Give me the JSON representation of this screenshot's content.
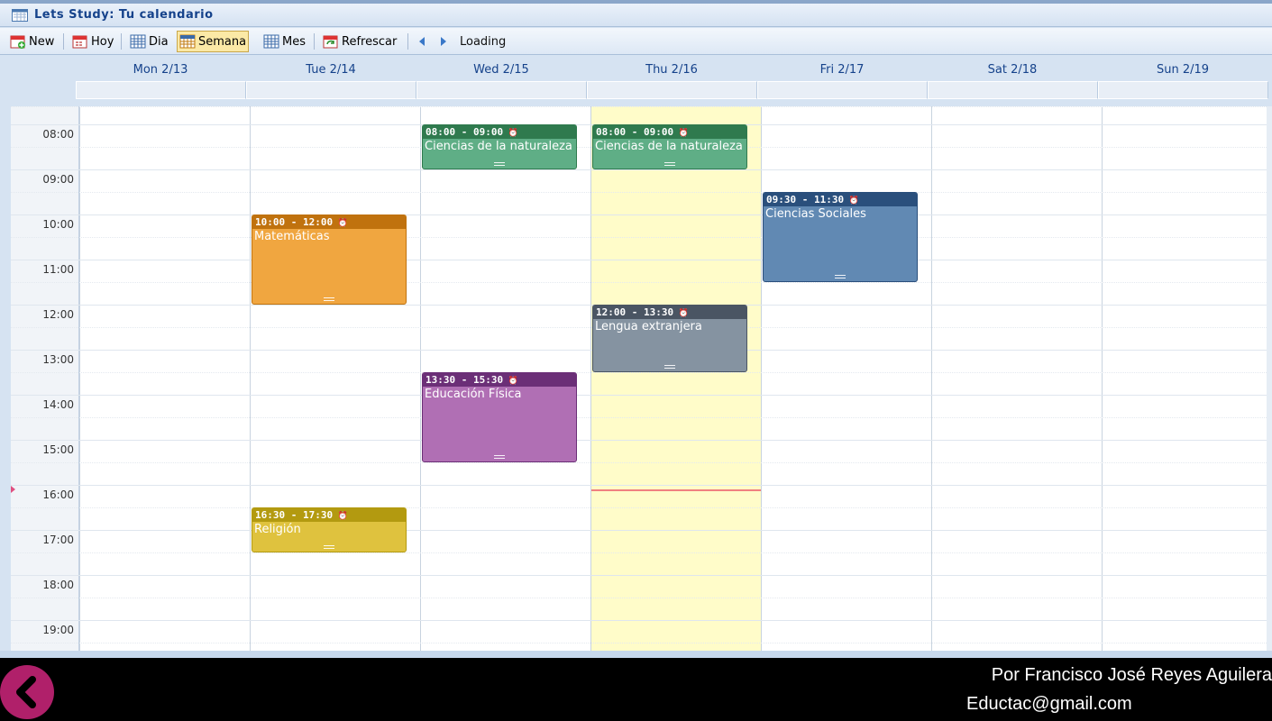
{
  "window": {
    "title": "Lets Study: Tu calendario"
  },
  "toolbar": {
    "new_label": "New",
    "today_label": "Hoy",
    "day_label": "Dia",
    "week_label": "Semana",
    "month_label": "Mes",
    "refresh_label": "Refrescar",
    "status": "Loading",
    "active_view": "Semana"
  },
  "days": [
    {
      "label": "Mon 2/13"
    },
    {
      "label": "Tue 2/14"
    },
    {
      "label": "Wed 2/15"
    },
    {
      "label": "Thu 2/16",
      "today": true
    },
    {
      "label": "Fri 2/17"
    },
    {
      "label": "Sat 2/18"
    },
    {
      "label": "Sun 2/19"
    }
  ],
  "hours": [
    "08:00",
    "09:00",
    "10:00",
    "11:00",
    "12:00",
    "13:00",
    "14:00",
    "15:00",
    "16:00",
    "17:00",
    "18:00",
    "19:00"
  ],
  "events": [
    {
      "day": 2,
      "time": "08:00 - 09:00",
      "title": "Ciencias de la naturaleza",
      "start": 8.0,
      "end": 9.0,
      "head_color": "#2f7a4e",
      "body_color": "#5fae86"
    },
    {
      "day": 3,
      "time": "08:00 - 09:00",
      "title": "Ciencias de la naturaleza",
      "start": 8.0,
      "end": 9.0,
      "head_color": "#2f7a4e",
      "body_color": "#5fae86"
    },
    {
      "day": 4,
      "time": "09:30 - 11:30",
      "title": "Ciencias Sociales",
      "start": 9.5,
      "end": 11.5,
      "head_color": "#2a4f7c",
      "body_color": "#6189b3"
    },
    {
      "day": 1,
      "time": "10:00 - 12:00",
      "title": "Matemáticas",
      "start": 10.0,
      "end": 12.0,
      "head_color": "#c0720e",
      "body_color": "#f0a640"
    },
    {
      "day": 3,
      "time": "12:00 - 13:30",
      "title": "Lengua extranjera",
      "start": 12.0,
      "end": 13.5,
      "head_color": "#4a5563",
      "body_color": "#8593a1"
    },
    {
      "day": 2,
      "time": "13:30 - 15:30",
      "title": "Educación Física",
      "start": 13.5,
      "end": 15.5,
      "head_color": "#6b2f77",
      "body_color": "#b06fb4"
    },
    {
      "day": 1,
      "time": "16:30 - 17:30",
      "title": "Religión",
      "start": 16.5,
      "end": 17.5,
      "head_color": "#b39a10",
      "body_color": "#dfc23e"
    }
  ],
  "current_time": 16.1,
  "footer": {
    "credit_name": "Por Francisco José Reyes Aguilera",
    "credit_email": "Eductac@gmail.com"
  },
  "icons": {
    "back": "chevron-left-icon",
    "alarm": "alarm-clock-icon"
  }
}
